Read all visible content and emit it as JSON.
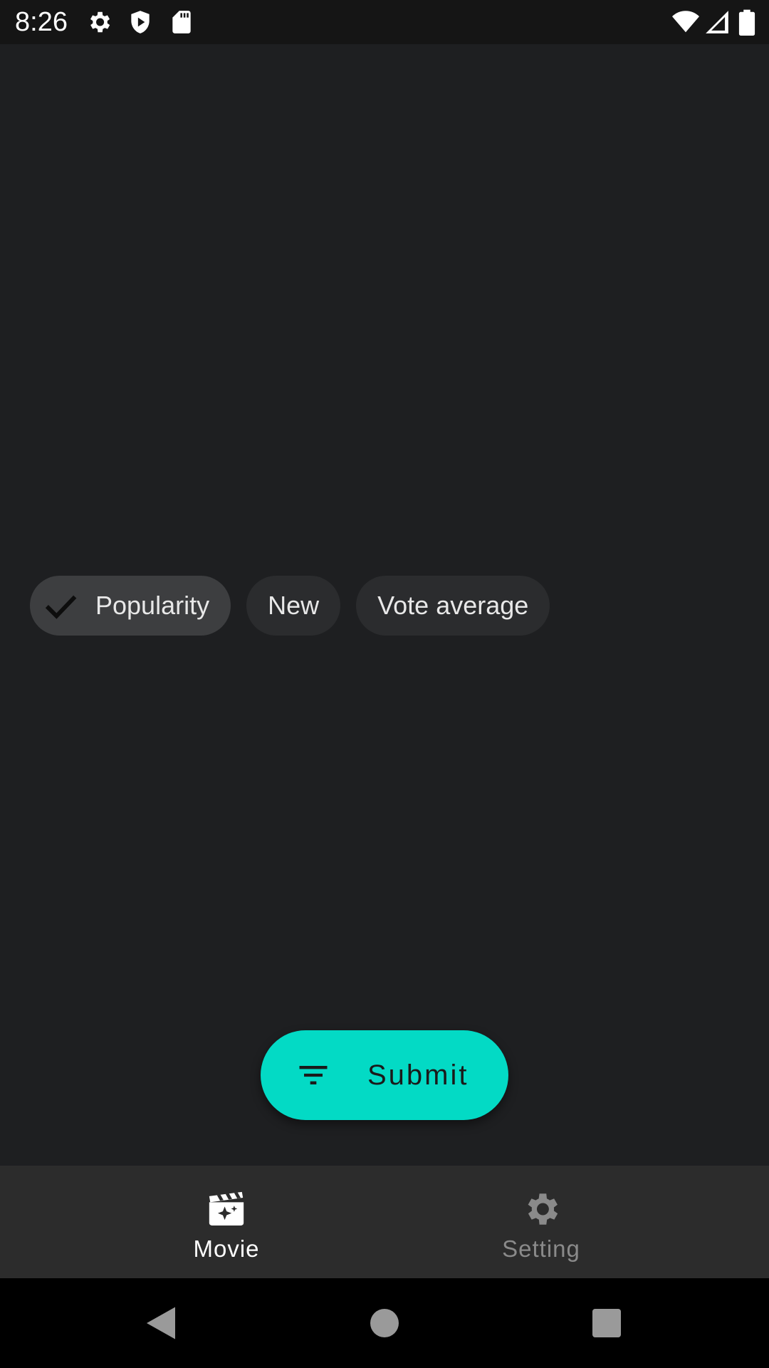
{
  "status_bar": {
    "time": "8:26",
    "left_icons": [
      "gear-icon",
      "shield-play-icon",
      "sd-card-icon"
    ],
    "right_icons": [
      "wifi-icon",
      "cell-signal-icon",
      "battery-icon"
    ]
  },
  "sort_chips": [
    {
      "label": "Popularity",
      "selected": true
    },
    {
      "label": "New",
      "selected": false
    },
    {
      "label": "Vote average",
      "selected": false
    }
  ],
  "fab": {
    "label": "Submit",
    "icon": "filter-icon",
    "color": "#03dac5"
  },
  "bottom_nav": {
    "items": [
      {
        "label": "Movie",
        "icon": "movie-clapper-icon",
        "active": true
      },
      {
        "label": "Setting",
        "icon": "gear-icon",
        "active": false
      }
    ]
  },
  "system_nav": {
    "buttons": [
      "back-icon",
      "home-icon",
      "recents-icon"
    ]
  },
  "colors": {
    "background": "#1e1f21",
    "accent": "#03dac5",
    "chip": "#2b2c2e",
    "chip_selected": "#3d3e40",
    "nav_bar": "#2c2c2c",
    "inactive": "#8a8a8a"
  }
}
